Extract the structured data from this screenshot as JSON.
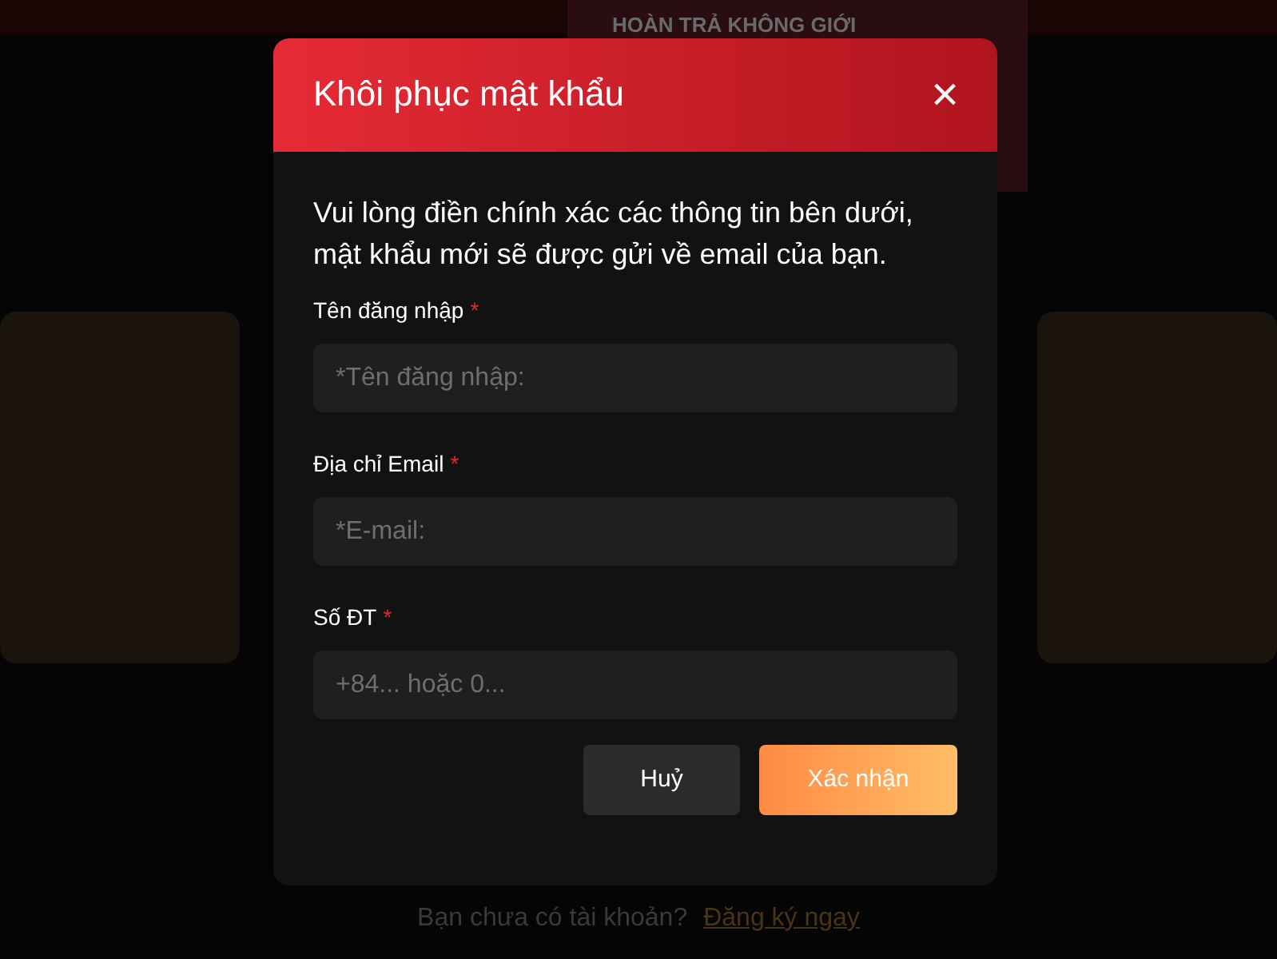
{
  "background": {
    "banner": {
      "headline": "HOÀN TRẢ KHÔNG GIỚI"
    },
    "signup_prompt": {
      "text": "Bạn chưa có tài khoản?",
      "link": "Đăng ký ngay"
    }
  },
  "dialog": {
    "title": "Khôi phục mật khẩu",
    "close": "×",
    "description": "Vui lòng điền chính xác các thông tin bên dưới, mật khẩu mới sẽ được gửi về email của bạn.",
    "fields": [
      {
        "label": "Tên đăng nhập",
        "required_mark": "*",
        "placeholder": "*Tên đăng nhập:"
      },
      {
        "label": "Địa chỉ Email",
        "required_mark": "*",
        "placeholder": "*E-mail:"
      },
      {
        "label": "Số ĐT",
        "required_mark": "*",
        "placeholder": "+84... hoặc 0..."
      }
    ],
    "buttons": [
      {
        "label": "Huỷ",
        "kind": "secondary"
      },
      {
        "label": "Xác nhận",
        "kind": "primary"
      }
    ]
  }
}
